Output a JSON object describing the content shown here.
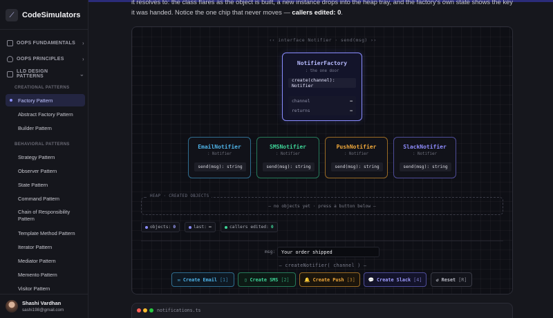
{
  "brand": {
    "name": "CodeSimulators",
    "logo_icon": "code-icon"
  },
  "sidebar": {
    "sections": [
      {
        "label": "OOPS FUNDAMENTALS",
        "icon": "book-icon",
        "chevron": "›"
      },
      {
        "label": "OOPS PRINCIPLES",
        "icon": "shield-icon",
        "chevron": "›"
      },
      {
        "label": "LLD DESIGN PATTERNS",
        "icon": "layers-icon",
        "chevron": "⌄"
      }
    ],
    "creational_label": "CREATIONAL PATTERNS",
    "creational": [
      "Factory Pattern",
      "Abstract Factory Pattern",
      "Builder Pattern"
    ],
    "behavioral_label": "BEHAVIORAL PATTERNS",
    "behavioral": [
      "Strategy Pattern",
      "Observer Pattern",
      "State Pattern",
      "Command Pattern",
      "Chain of Responsibility Pattern",
      "Template Method Pattern",
      "Iterator Pattern",
      "Mediator Pattern",
      "Memento Pattern",
      "Visitor Pattern"
    ],
    "active": "Factory Pattern"
  },
  "user": {
    "name": "Shashi Vardhan",
    "email": "sashi198@gmail.com"
  },
  "intro": {
    "line1": "it resolves to: the class flares as the object is built, a new instance drops into the heap tray, and the factory's own state shows the key",
    "line2_pre": "it was handed. Notice the one chip that never moves — ",
    "line2_bold": "callers edited: 0",
    "line2_post": "."
  },
  "sim": {
    "interface_label": "‹‹ interface Notifier · send(msg) ››",
    "factory": {
      "title": "NotifierFactory",
      "stereotype": ": the one door",
      "method": "create(channel): Notifier",
      "rows": [
        {
          "label": "channel",
          "value": "—"
        },
        {
          "label": "returns",
          "value": "—"
        }
      ]
    },
    "products": [
      {
        "title": "EmailNotifier",
        "stereotype": ": Notifier",
        "method": "send(msg): string",
        "color": "#4fb3e8"
      },
      {
        "title": "SMSNotifier",
        "stereotype": ": Notifier",
        "method": "send(msg): string",
        "color": "#3ed598"
      },
      {
        "title": "PushNotifier",
        "stereotype": ": Notifier",
        "method": "send(msg): string",
        "color": "#f0a83a"
      },
      {
        "title": "SlackNotifier",
        "stereotype": ": Notifier",
        "method": "send(msg): string",
        "color": "#8f8cff"
      }
    ],
    "heap": {
      "label": "HEAP · CREATED OBJECTS",
      "empty": "— no objects yet · press a button below —"
    },
    "stats": [
      {
        "label": "objects:",
        "value": "0",
        "color": "#8a8dff"
      },
      {
        "label": "last:",
        "value": "—",
        "color": "#8a8dff"
      },
      {
        "label": "callers edited:",
        "value": "0",
        "color": "#3ed598"
      }
    ],
    "msg_label": "msg:",
    "msg_value": "Your order shipped",
    "call_label": "— createNotifier( channel ) —",
    "buttons": [
      {
        "icon": "✉",
        "label": "Create Email",
        "key": "[1]",
        "color": "#4fb3e8"
      },
      {
        "icon": "▯",
        "label": "Create SMS",
        "key": "[2]",
        "color": "#3ed598"
      },
      {
        "icon": "🔔",
        "label": "Create Push",
        "key": "[3]",
        "color": "#f0a83a"
      },
      {
        "icon": "💬",
        "label": "Create Slack",
        "key": "[4]",
        "color": "#8f8cff"
      },
      {
        "icon": "↺",
        "label": "Reset",
        "key": "[R]",
        "color": "#b9bac4"
      }
    ]
  },
  "code": {
    "filename": "notifications.ts",
    "dots": [
      "#ff5f57",
      "#febc2e",
      "#28c840"
    ]
  }
}
